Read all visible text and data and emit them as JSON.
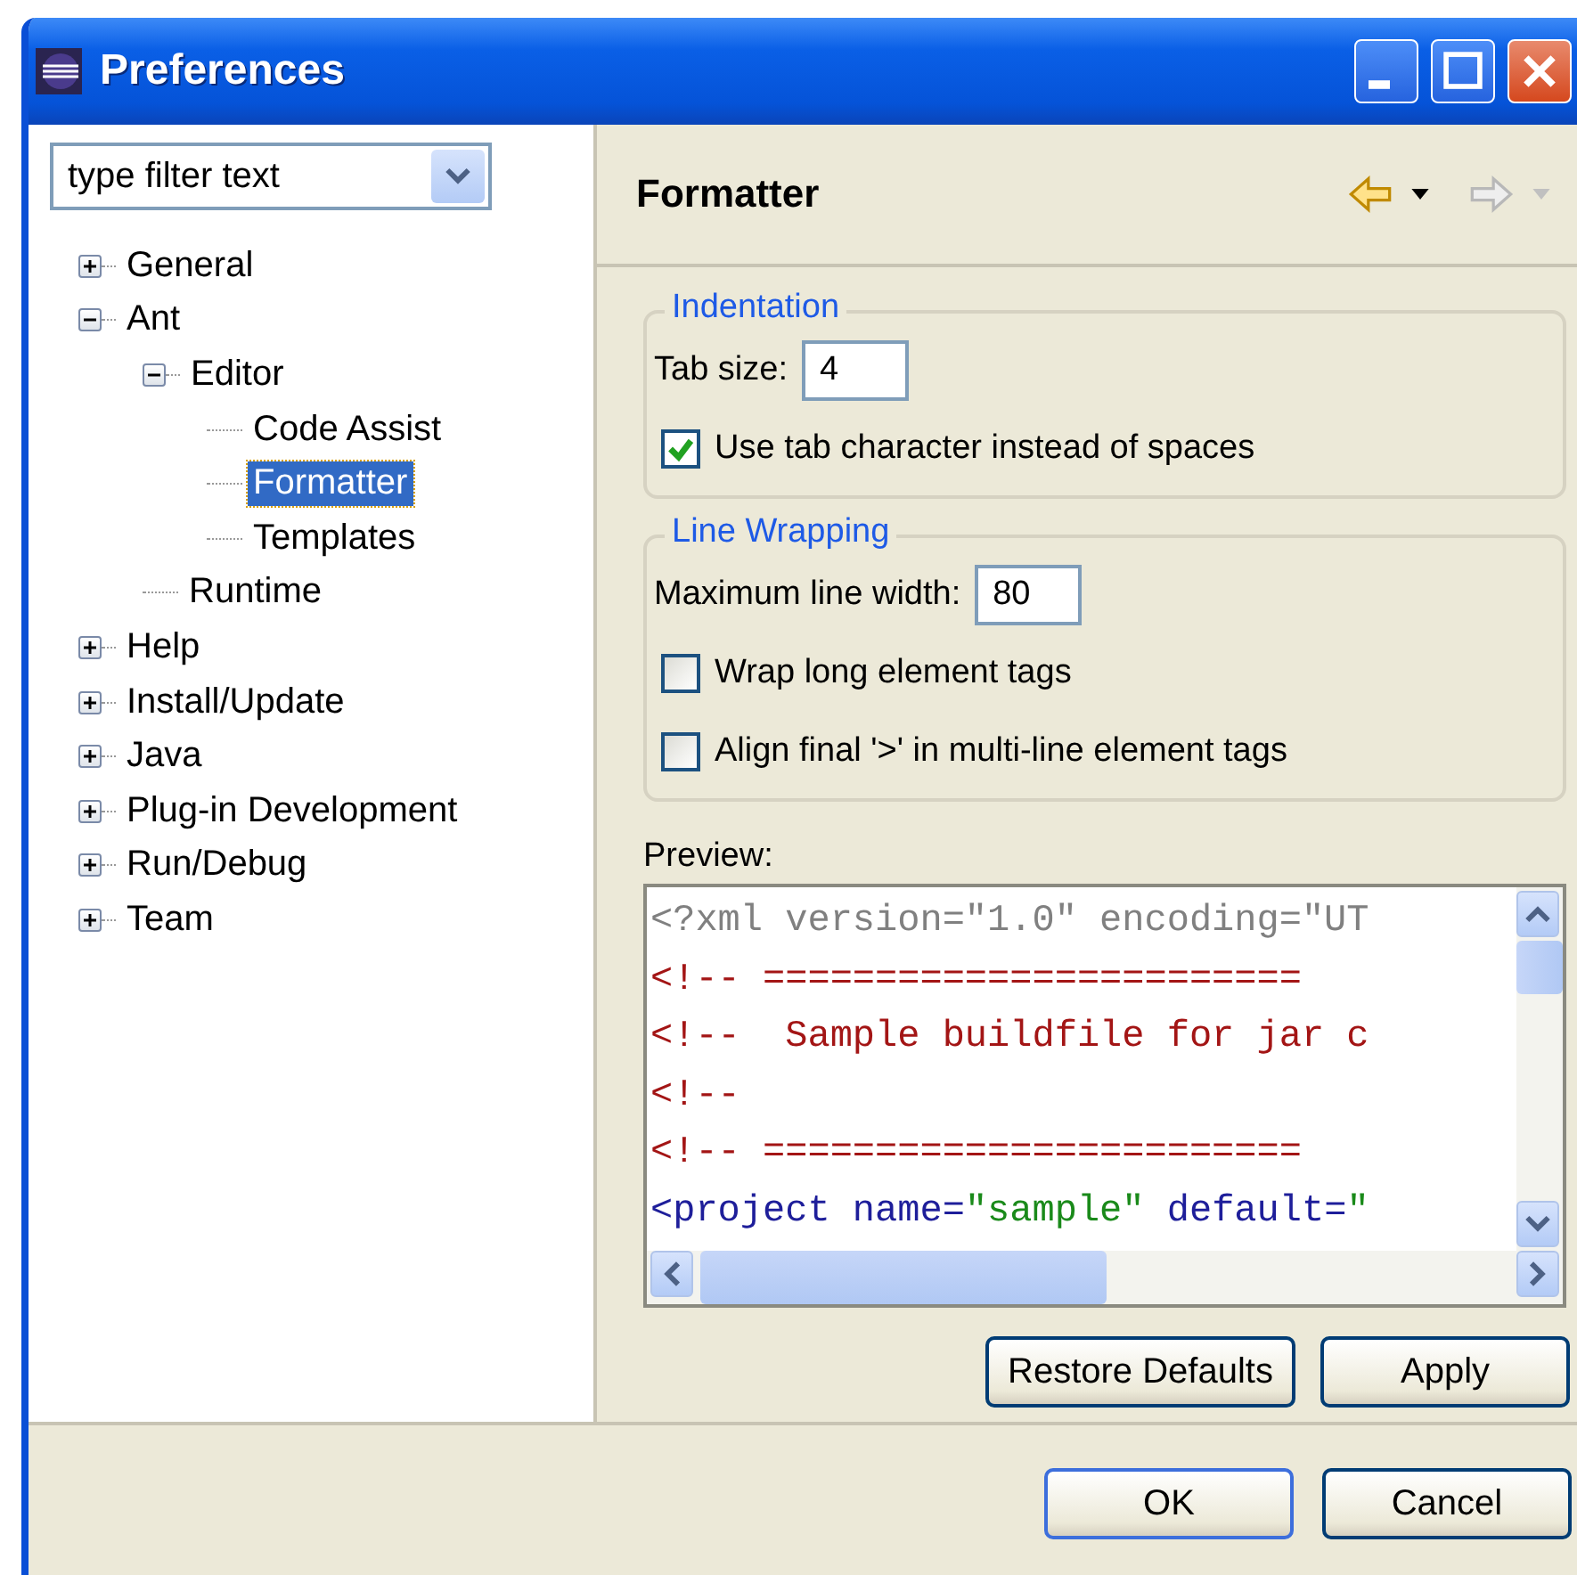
{
  "window": {
    "title": "Preferences"
  },
  "filter": {
    "placeholder": "type filter text"
  },
  "tree": [
    {
      "label": "General",
      "expanded": false,
      "selected": false
    },
    {
      "label": "Ant",
      "expanded": true,
      "selected": false,
      "children": [
        {
          "label": "Editor",
          "expanded": true,
          "selected": false,
          "children": [
            {
              "label": "Code Assist",
              "selected": false
            },
            {
              "label": "Formatter",
              "selected": true
            },
            {
              "label": "Templates",
              "selected": false
            }
          ]
        },
        {
          "label": "Runtime",
          "selected": false
        }
      ]
    },
    {
      "label": "Help",
      "expanded": false,
      "selected": false
    },
    {
      "label": "Install/Update",
      "expanded": false,
      "selected": false
    },
    {
      "label": "Java",
      "expanded": false,
      "selected": false
    },
    {
      "label": "Plug-in Development",
      "expanded": false,
      "selected": false
    },
    {
      "label": "Run/Debug",
      "expanded": false,
      "selected": false
    },
    {
      "label": "Team",
      "expanded": false,
      "selected": false
    }
  ],
  "page": {
    "title": "Formatter",
    "back_disabled": false,
    "forward_disabled": true
  },
  "groups": [
    {
      "title": "Indentation",
      "items": [
        {
          "kind": "field",
          "label": "Tab size:",
          "value": "4"
        },
        {
          "kind": "checkbox",
          "label": "Use tab character instead of spaces",
          "checked": true
        }
      ]
    },
    {
      "title": "Line Wrapping",
      "items": [
        {
          "kind": "field",
          "label": "Maximum line width:",
          "value": "80"
        },
        {
          "kind": "checkbox",
          "label": "Wrap long element tags",
          "checked": false
        },
        {
          "kind": "checkbox",
          "label": "Align final '>' in multi-line element tags",
          "checked": false
        }
      ]
    }
  ],
  "preview": {
    "label": "Preview:",
    "lines": [
      [
        {
          "kind": "declaration",
          "text": "<?xml version=\"1.0\" encoding=\"UT"
        }
      ],
      [
        {
          "kind": "comment",
          "text": "<!-- ========================"
        }
      ],
      [
        {
          "kind": "comment",
          "text": "<!--  Sample buildfile for jar c"
        }
      ],
      [
        {
          "kind": "comment",
          "text": "<!--"
        }
      ],
      [
        {
          "kind": "comment",
          "text": "<!-- ========================"
        }
      ],
      [
        {
          "kind": "tag",
          "text": "<project name="
        },
        {
          "kind": "string",
          "text": "\"sample\""
        },
        {
          "kind": "tag",
          "text": " default="
        },
        {
          "kind": "string",
          "text": "\""
        }
      ]
    ]
  },
  "page_buttons": [
    "Restore Defaults",
    "Apply"
  ],
  "dialog_buttons": [
    "OK",
    "Cancel"
  ]
}
